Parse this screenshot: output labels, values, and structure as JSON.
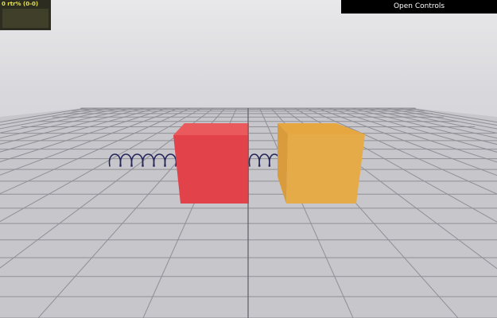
{
  "stats_panel": {
    "fps_text": "0 rtr% (0-0)"
  },
  "controls": {
    "toggle_label": "Open Controls"
  },
  "scene": {
    "colors": {
      "sky_top": "#e8e8eb",
      "floor": "#c4c4c9",
      "grid_line": "#8d8d93",
      "grid_center": "#5d5d62",
      "spring": "#26265a",
      "red_box": "#e24346",
      "yellow_box": "#e8a945"
    },
    "objects": [
      "spring",
      "red-box",
      "yellow-box",
      "floor-grid"
    ]
  }
}
